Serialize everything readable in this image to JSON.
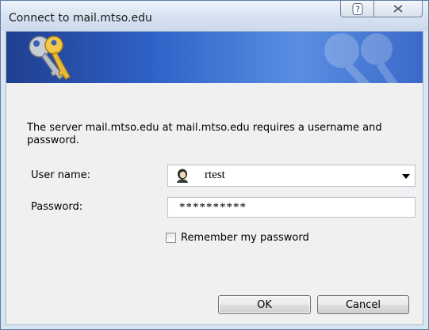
{
  "window": {
    "title": "Connect to mail.mtso.edu"
  },
  "titlebar": {
    "help_glyph": "?",
    "help_icon": "help-icon",
    "close_icon": "close-icon"
  },
  "banner": {
    "icon": "keys-icon",
    "watermark_icon": "keys-watermark-icon"
  },
  "message": "The server mail.mtso.edu at mail.mtso.edu requires a username and password.",
  "form": {
    "username_label": "User name:",
    "username_value": "rtest",
    "username_icon": "user-icon",
    "password_label": "Password:",
    "password_value": "**********",
    "remember_label": "Remember my password",
    "remember_checked": false
  },
  "buttons": {
    "ok": "OK",
    "cancel": "Cancel"
  },
  "colors": {
    "banner_dark": "#1f3f8f",
    "banner_light": "#5a8ee3",
    "window_frame": "#d9e4f1"
  }
}
